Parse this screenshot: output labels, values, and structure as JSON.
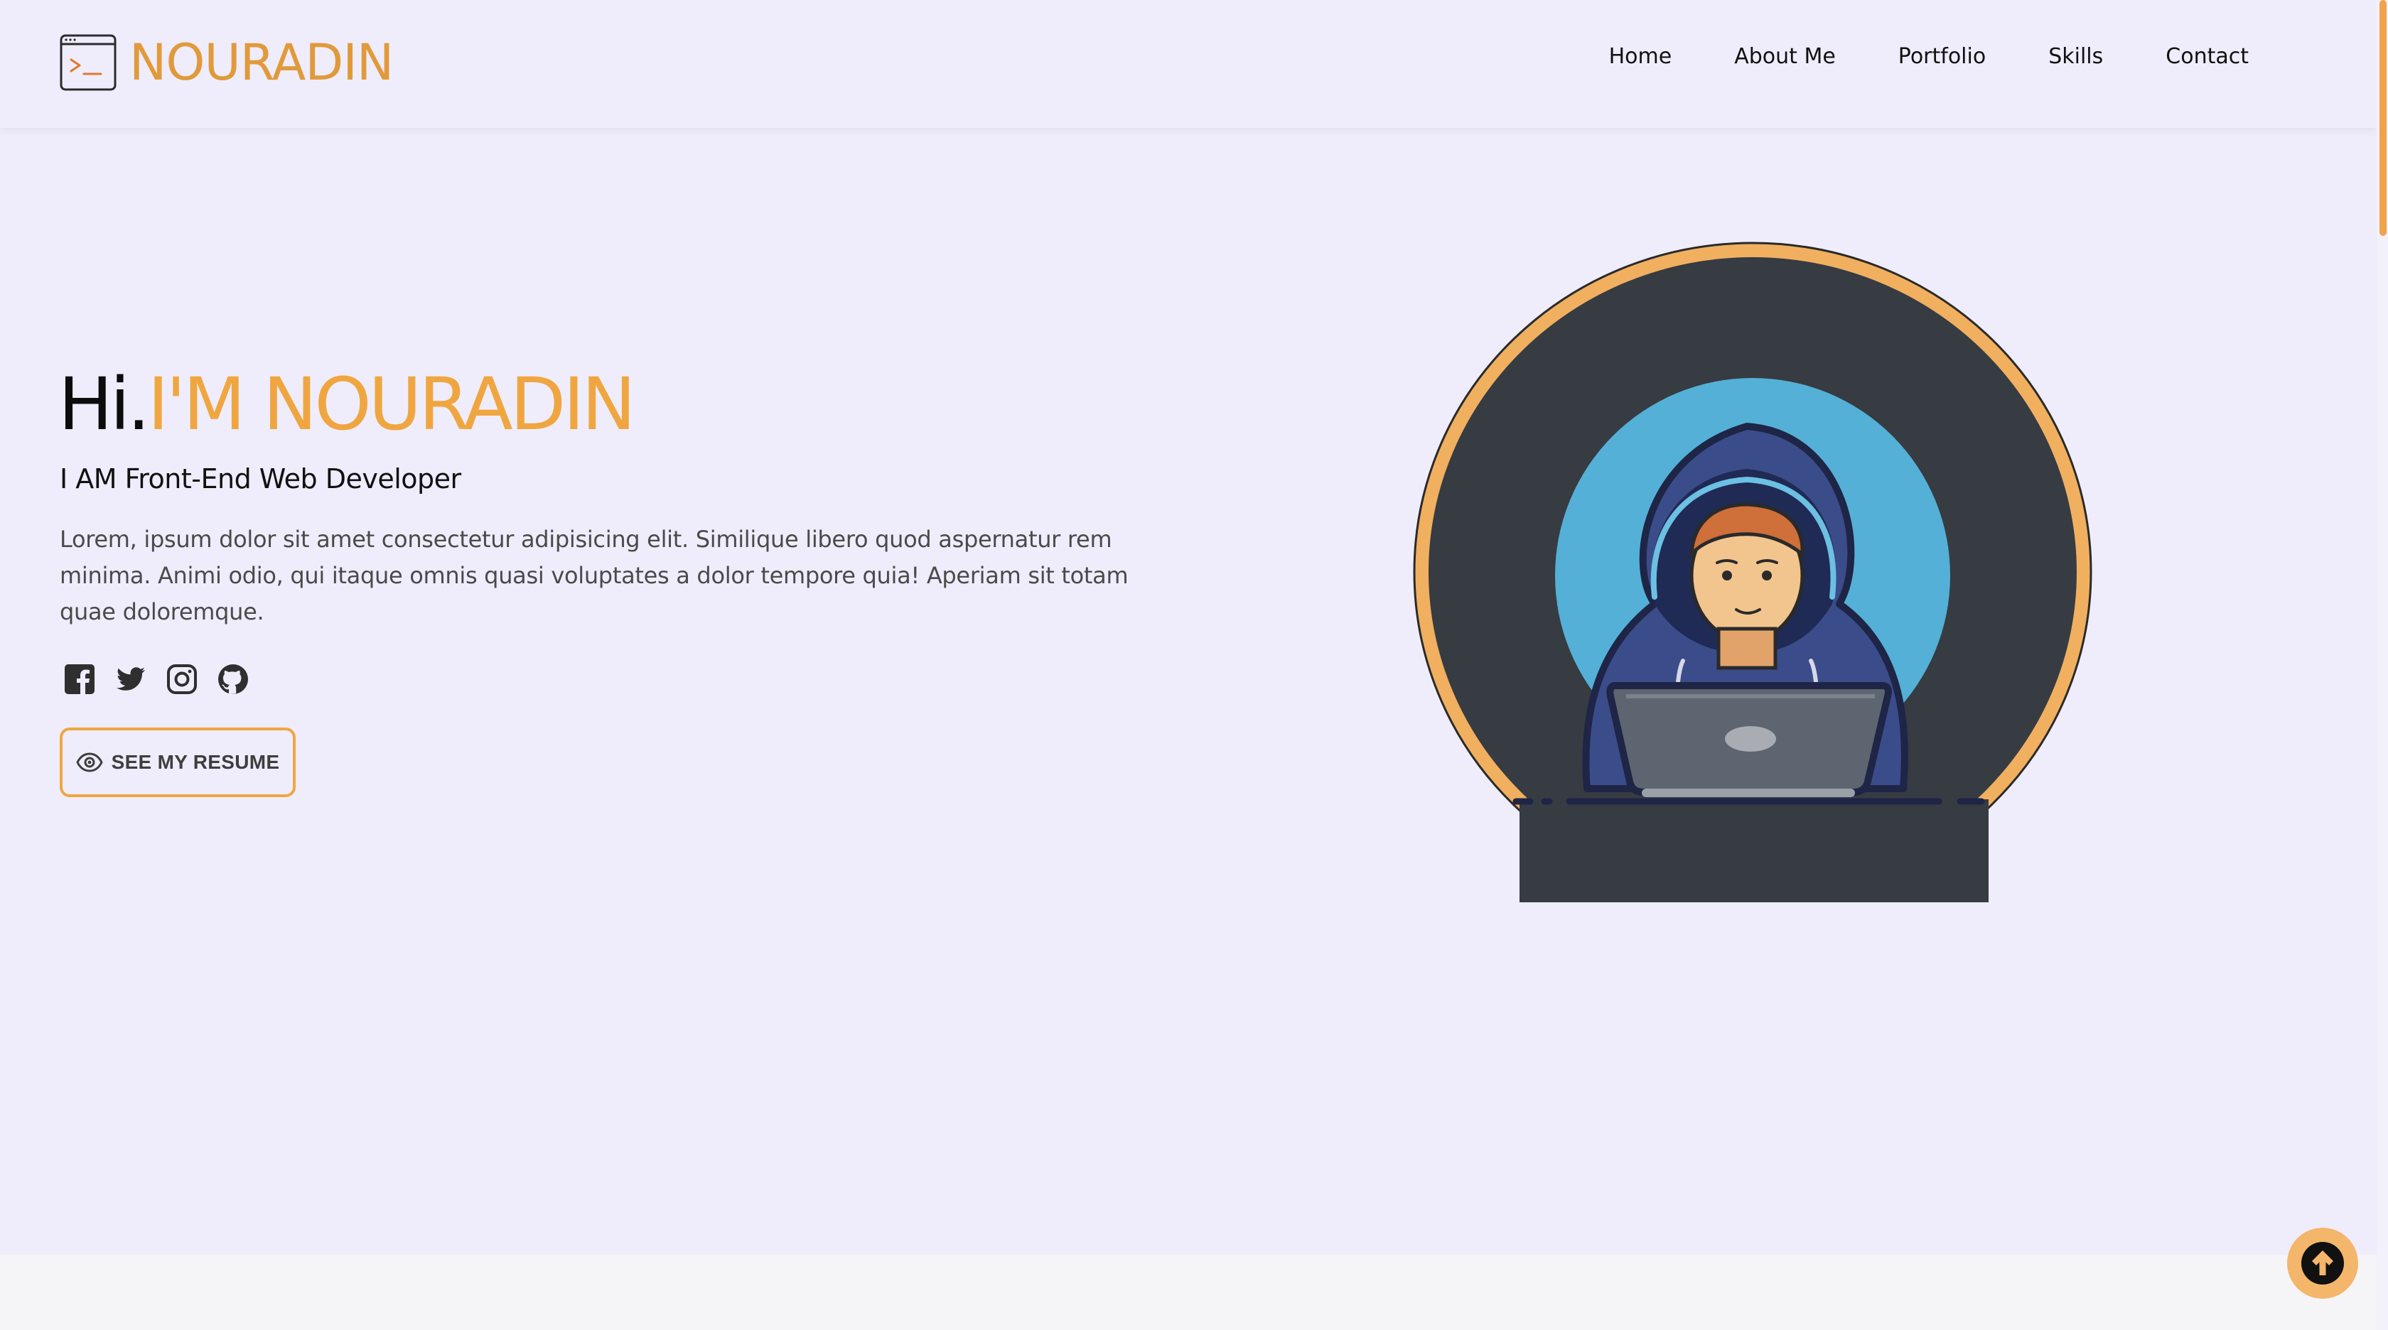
{
  "brand": {
    "logo_text": "NOURADIN",
    "logo_icon": "terminal-window-icon",
    "accent_color": "#f0a640"
  },
  "nav": {
    "items": [
      {
        "label": "Home"
      },
      {
        "label": "About Me"
      },
      {
        "label": "Portfolio"
      },
      {
        "label": "Skills"
      },
      {
        "label": "Contact"
      }
    ]
  },
  "hero": {
    "greeting": "Hi.",
    "name": "I'M NOURADIN",
    "subtitle": "I AM Front-End Web Developer",
    "description": "Lorem, ipsum dolor sit amet consectetur adipisicing elit. Similique libero quod aspernatur rem minima. Animi odio, qui itaque omnis quasi voluptates a dolor tempore quia! Aperiam sit totam quae doloremque.",
    "socials": [
      {
        "icon": "facebook-icon"
      },
      {
        "icon": "twitter-icon"
      },
      {
        "icon": "instagram-icon"
      },
      {
        "icon": "github-icon"
      }
    ],
    "resume_button": {
      "label": "SEE MY RESUME",
      "icon": "eye-icon"
    },
    "avatar": {
      "description_icon": "developer-hoodie-laptop-avatar",
      "ring_color": "#f0b060",
      "bg_color": "#373b42",
      "halo_color": "#54b0d6"
    }
  },
  "back_to_top": {
    "icon": "arrow-up-circle-icon",
    "bg_color": "#f4b66a"
  }
}
